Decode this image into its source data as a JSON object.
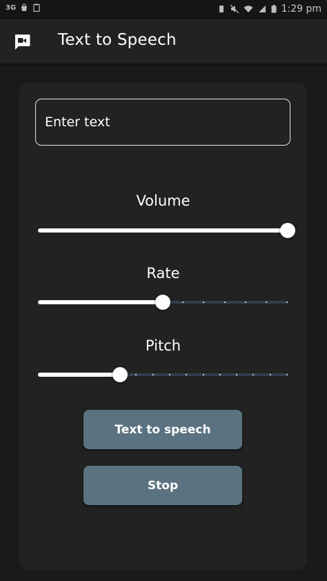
{
  "status_bar": {
    "left_text": "3G",
    "left_icons": [
      "bag-icon",
      "clipboard-icon"
    ],
    "right_icons": [
      "vibrate-icon",
      "mute-icon",
      "wifi-icon",
      "signal-icon",
      "battery-icon"
    ],
    "time": "1:29 pm"
  },
  "app_bar": {
    "icon": "feedback-video-icon",
    "title": "Text to Speech"
  },
  "form": {
    "text_input": {
      "placeholder": "Enter text",
      "value": ""
    },
    "sliders": [
      {
        "label": "Volume",
        "value": 1.0,
        "ticks": 0
      },
      {
        "label": "Rate",
        "value": 0.5,
        "ticks": 6
      },
      {
        "label": "Pitch",
        "value": 0.33,
        "ticks": 10
      }
    ],
    "speak_button": "Text to speech",
    "stop_button": "Stop"
  },
  "colors": {
    "background": "#1a1a1a",
    "app_bar": "#222222",
    "card": "#222222",
    "button": "#5b7380",
    "slider_track_inactive": "#2f3f4f",
    "slider_active": "#ffffff"
  }
}
